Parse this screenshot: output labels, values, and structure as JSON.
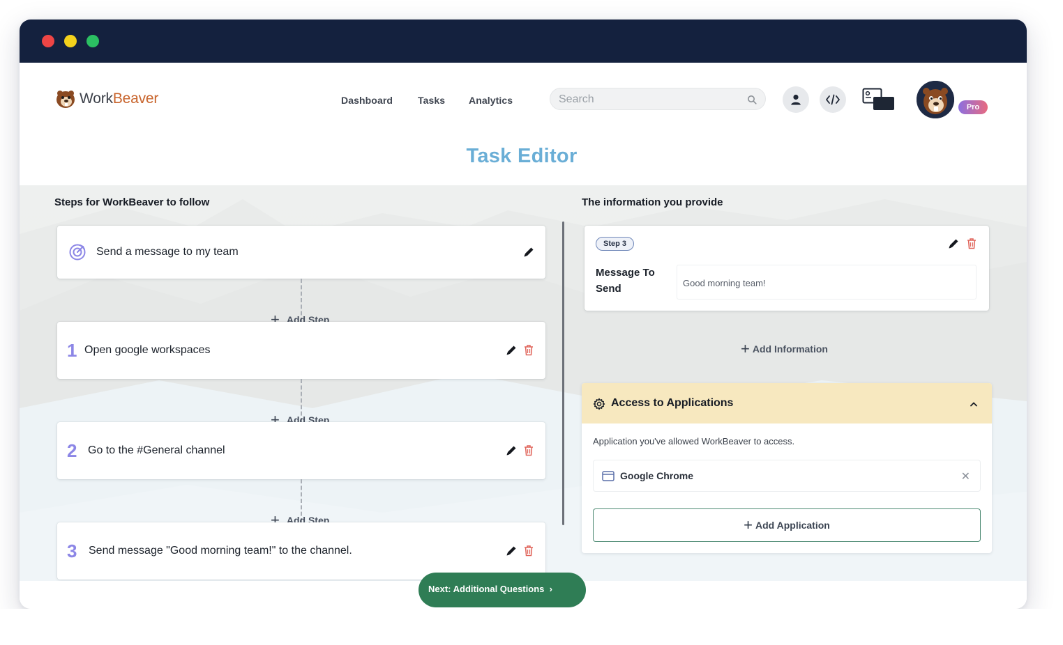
{
  "window": {
    "controls": [
      "close",
      "minimize",
      "maximize"
    ],
    "colors": {
      "titlebar": "#14213e",
      "close": "#ee4545",
      "minimize": "#f4d21c",
      "maximize": "#2bc062"
    }
  },
  "header": {
    "logo": {
      "part1": "Work",
      "part2": "Beaver",
      "icon": "beaver-logo-icon"
    },
    "nav": [
      "Dashboard",
      "Tasks",
      "Analytics"
    ],
    "search": {
      "placeholder": "Search",
      "value": "",
      "icon": "search-icon"
    },
    "actions": [
      "user-icon",
      "code-icon",
      "screen-share-icon"
    ],
    "avatar": "beaver-avatar",
    "badge": "Pro"
  },
  "page": {
    "title": "Task Editor"
  },
  "steps_panel": {
    "title": "Steps for WorkBeaver to follow",
    "goal": {
      "label": "Send a message to my team",
      "icon": "target-icon"
    },
    "add_step_label": "Add Step",
    "steps": [
      {
        "number": "1",
        "label": "Open google workspaces"
      },
      {
        "number": "2",
        "label": "Go to the #General channel"
      },
      {
        "number": "3",
        "label": "Send message \"Good morning team!\" to the channel."
      }
    ]
  },
  "info_panel": {
    "title": "The information you provide",
    "card": {
      "step_chip": "Step 3",
      "label": "Message To Send",
      "value": "Good morning team!"
    },
    "add_information_label": "Add Information"
  },
  "access_panel": {
    "title": "Access to Applications",
    "description": "Application you've allowed WorkBeaver to access.",
    "apps": [
      {
        "name": "Google Chrome",
        "icon": "browser-window-icon"
      }
    ],
    "add_application_label": "Add Application",
    "colors": {
      "header_bg": "#f7e8bf",
      "button_border": "#4d8a73"
    }
  },
  "footer": {
    "next_label": "Next: Additional Questions",
    "next_color": "#2f7d55"
  },
  "colors": {
    "title": "#6aaed6",
    "step_number": "#8c86e6",
    "trash": "#e0645a",
    "accent": "#c8642c"
  }
}
